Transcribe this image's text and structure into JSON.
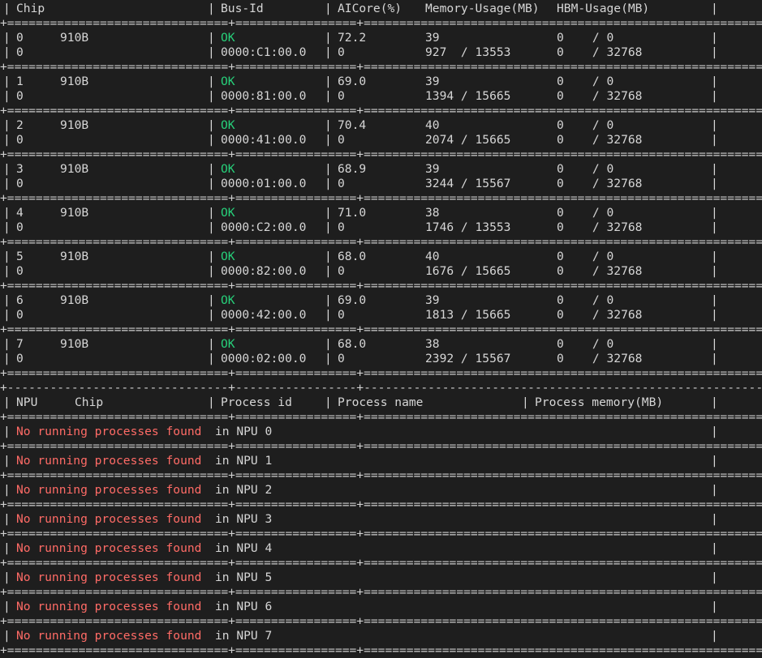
{
  "colors": {
    "background": "#1e1e1e",
    "text": "#d6d6d6",
    "ok": "#27d07a",
    "error": "#ff6b66"
  },
  "npu_header": {
    "chip": "Chip",
    "bus_id": "Bus-Id",
    "aicore": "AICore(%)",
    "memory_usage": "Memory-Usage(MB)",
    "hbm_usage": "HBM-Usage(MB)"
  },
  "npu_rows": [
    {
      "npu": "0",
      "name": "910B",
      "status": "OK",
      "aicore": "72.2",
      "memory_a": "39",
      "hbm_a": "0    / 0",
      "chip": "0",
      "bus_id": "0000:C1:00.0",
      "aicore_b": "0",
      "memory_b": "927  / 13553",
      "hbm_b": "0    / 32768"
    },
    {
      "npu": "1",
      "name": "910B",
      "status": "OK",
      "aicore": "69.0",
      "memory_a": "39",
      "hbm_a": "0    / 0",
      "chip": "0",
      "bus_id": "0000:81:00.0",
      "aicore_b": "0",
      "memory_b": "1394 / 15665",
      "hbm_b": "0    / 32768"
    },
    {
      "npu": "2",
      "name": "910B",
      "status": "OK",
      "aicore": "70.4",
      "memory_a": "40",
      "hbm_a": "0    / 0",
      "chip": "0",
      "bus_id": "0000:41:00.0",
      "aicore_b": "0",
      "memory_b": "2074 / 15665",
      "hbm_b": "0    / 32768"
    },
    {
      "npu": "3",
      "name": "910B",
      "status": "OK",
      "aicore": "68.9",
      "memory_a": "39",
      "hbm_a": "0    / 0",
      "chip": "0",
      "bus_id": "0000:01:00.0",
      "aicore_b": "0",
      "memory_b": "3244 / 15567",
      "hbm_b": "0    / 32768"
    },
    {
      "npu": "4",
      "name": "910B",
      "status": "OK",
      "aicore": "71.0",
      "memory_a": "38",
      "hbm_a": "0    / 0",
      "chip": "0",
      "bus_id": "0000:C2:00.0",
      "aicore_b": "0",
      "memory_b": "1746 / 13553",
      "hbm_b": "0    / 32768"
    },
    {
      "npu": "5",
      "name": "910B",
      "status": "OK",
      "aicore": "68.0",
      "memory_a": "40",
      "hbm_a": "0    / 0",
      "chip": "0",
      "bus_id": "0000:82:00.0",
      "aicore_b": "0",
      "memory_b": "1676 / 15665",
      "hbm_b": "0    / 32768"
    },
    {
      "npu": "6",
      "name": "910B",
      "status": "OK",
      "aicore": "69.0",
      "memory_a": "39",
      "hbm_a": "0    / 0",
      "chip": "0",
      "bus_id": "0000:42:00.0",
      "aicore_b": "0",
      "memory_b": "1813 / 15665",
      "hbm_b": "0    / 32768"
    },
    {
      "npu": "7",
      "name": "910B",
      "status": "OK",
      "aicore": "68.0",
      "memory_a": "38",
      "hbm_a": "0    / 0",
      "chip": "0",
      "bus_id": "0000:02:00.0",
      "aicore_b": "0",
      "memory_b": "2392 / 15567",
      "hbm_b": "0    / 32768"
    }
  ],
  "process_header": {
    "npu": "NPU",
    "chip": "Chip",
    "process_id": "Process id",
    "process_name": "Process name",
    "process_memory": "Process memory(MB)"
  },
  "process_rows": [
    {
      "message": "No running processes found",
      "suffix": "in NPU 0"
    },
    {
      "message": "No running processes found",
      "suffix": "in NPU 1"
    },
    {
      "message": "No running processes found",
      "suffix": "in NPU 2"
    },
    {
      "message": "No running processes found",
      "suffix": "in NPU 3"
    },
    {
      "message": "No running processes found",
      "suffix": "in NPU 4"
    },
    {
      "message": "No running processes found",
      "suffix": "in NPU 5"
    },
    {
      "message": "No running processes found",
      "suffix": "in NPU 6"
    },
    {
      "message": "No running processes found",
      "suffix": "in NPU 7"
    }
  ]
}
